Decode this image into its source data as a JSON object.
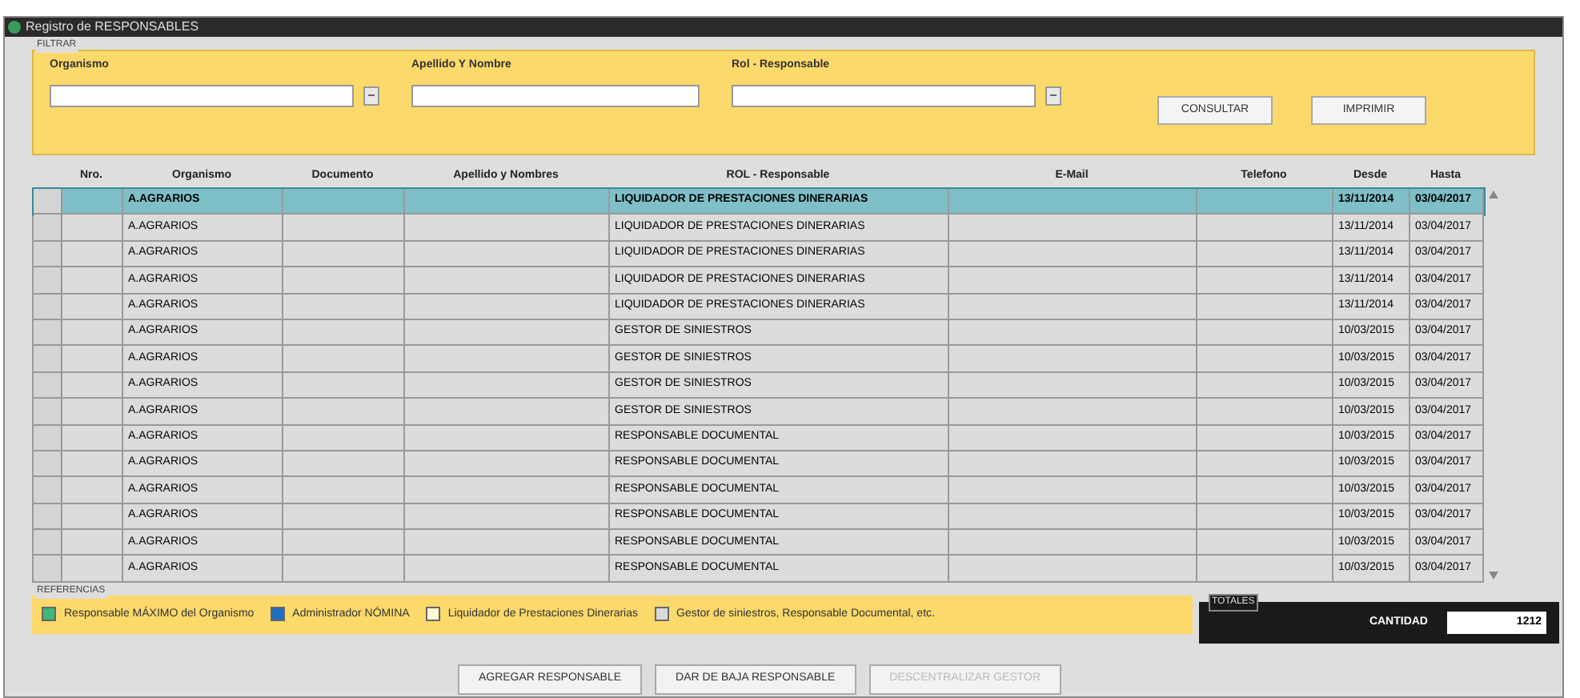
{
  "window": {
    "title": "Registro de RESPONSABLES"
  },
  "filter": {
    "legend": "FILTRAR",
    "fields": [
      {
        "label": "Organismo",
        "lookup": true
      },
      {
        "label": "Apellido Y Nombre",
        "lookup": false
      },
      {
        "label": "Rol - Responsable",
        "lookup": true
      }
    ],
    "buttons": [
      "CONSULTAR",
      "IMPRIMIR"
    ]
  },
  "table": {
    "columns": [
      "Nro.",
      "Organismo",
      "Documento",
      "Apellido y Nombres",
      "ROL - Responsable",
      "E-Mail",
      "Telefono",
      "Desde",
      "Hasta"
    ],
    "rows": [
      {
        "organismo": "A.AGRARIOS",
        "rol": "LIQUIDADOR DE PRESTACIONES DINERARIAS",
        "desde": "13/11/2014",
        "hasta": "03/04/2017",
        "selected": true
      },
      {
        "organismo": "A.AGRARIOS",
        "rol": "LIQUIDADOR DE PRESTACIONES DINERARIAS",
        "desde": "13/11/2014",
        "hasta": "03/04/2017",
        "selected": false
      },
      {
        "organismo": "A.AGRARIOS",
        "rol": "LIQUIDADOR DE PRESTACIONES DINERARIAS",
        "desde": "13/11/2014",
        "hasta": "03/04/2017",
        "selected": false
      },
      {
        "organismo": "A.AGRARIOS",
        "rol": "LIQUIDADOR DE PRESTACIONES DINERARIAS",
        "desde": "13/11/2014",
        "hasta": "03/04/2017",
        "selected": false
      },
      {
        "organismo": "A.AGRARIOS",
        "rol": "LIQUIDADOR DE PRESTACIONES DINERARIAS",
        "desde": "13/11/2014",
        "hasta": "03/04/2017",
        "selected": false
      },
      {
        "organismo": "A.AGRARIOS",
        "rol": "GESTOR DE SINIESTROS",
        "desde": "10/03/2015",
        "hasta": "03/04/2017",
        "selected": false
      },
      {
        "organismo": "A.AGRARIOS",
        "rol": "GESTOR DE SINIESTROS",
        "desde": "10/03/2015",
        "hasta": "03/04/2017",
        "selected": false
      },
      {
        "organismo": "A.AGRARIOS",
        "rol": "GESTOR DE SINIESTROS",
        "desde": "10/03/2015",
        "hasta": "03/04/2017",
        "selected": false
      },
      {
        "organismo": "A.AGRARIOS",
        "rol": "GESTOR DE SINIESTROS",
        "desde": "10/03/2015",
        "hasta": "03/04/2017",
        "selected": false
      },
      {
        "organismo": "A.AGRARIOS",
        "rol": "RESPONSABLE DOCUMENTAL",
        "desde": "10/03/2015",
        "hasta": "03/04/2017",
        "selected": false
      },
      {
        "organismo": "A.AGRARIOS",
        "rol": "RESPONSABLE DOCUMENTAL",
        "desde": "10/03/2015",
        "hasta": "03/04/2017",
        "selected": false
      },
      {
        "organismo": "A.AGRARIOS",
        "rol": "RESPONSABLE DOCUMENTAL",
        "desde": "10/03/2015",
        "hasta": "03/04/2017",
        "selected": false
      },
      {
        "organismo": "A.AGRARIOS",
        "rol": "RESPONSABLE DOCUMENTAL",
        "desde": "10/03/2015",
        "hasta": "03/04/2017",
        "selected": false
      },
      {
        "organismo": "A.AGRARIOS",
        "rol": "RESPONSABLE DOCUMENTAL",
        "desde": "10/03/2015",
        "hasta": "03/04/2017",
        "selected": false
      },
      {
        "organismo": "A.AGRARIOS",
        "rol": "RESPONSABLE DOCUMENTAL",
        "desde": "10/03/2015",
        "hasta": "03/04/2017",
        "selected": false
      }
    ]
  },
  "references": {
    "legend": "REFERENCIAS",
    "items": [
      {
        "label": "Responsable MÁXIMO del Organismo",
        "color": "#3cb878"
      },
      {
        "label": "Administrador NÓMINA",
        "color": "#1f6fc0"
      },
      {
        "label": "Liquidador de Prestaciones Dinerarias",
        "color": "#fffbd6"
      },
      {
        "label": "Gestor de siniestros, Responsable Documental, etc.",
        "color": "#d8d8d8"
      }
    ]
  },
  "totals": {
    "legend": "TOTALES",
    "label": "CANTIDAD",
    "value": "1212"
  },
  "actions": [
    {
      "label": "AGREGAR RESPONSABLE",
      "disabled": false
    },
    {
      "label": "DAR DE BAJA RESPONSABLE",
      "disabled": false
    },
    {
      "label": "DESCENTRALIZAR GESTOR",
      "disabled": true
    }
  ]
}
